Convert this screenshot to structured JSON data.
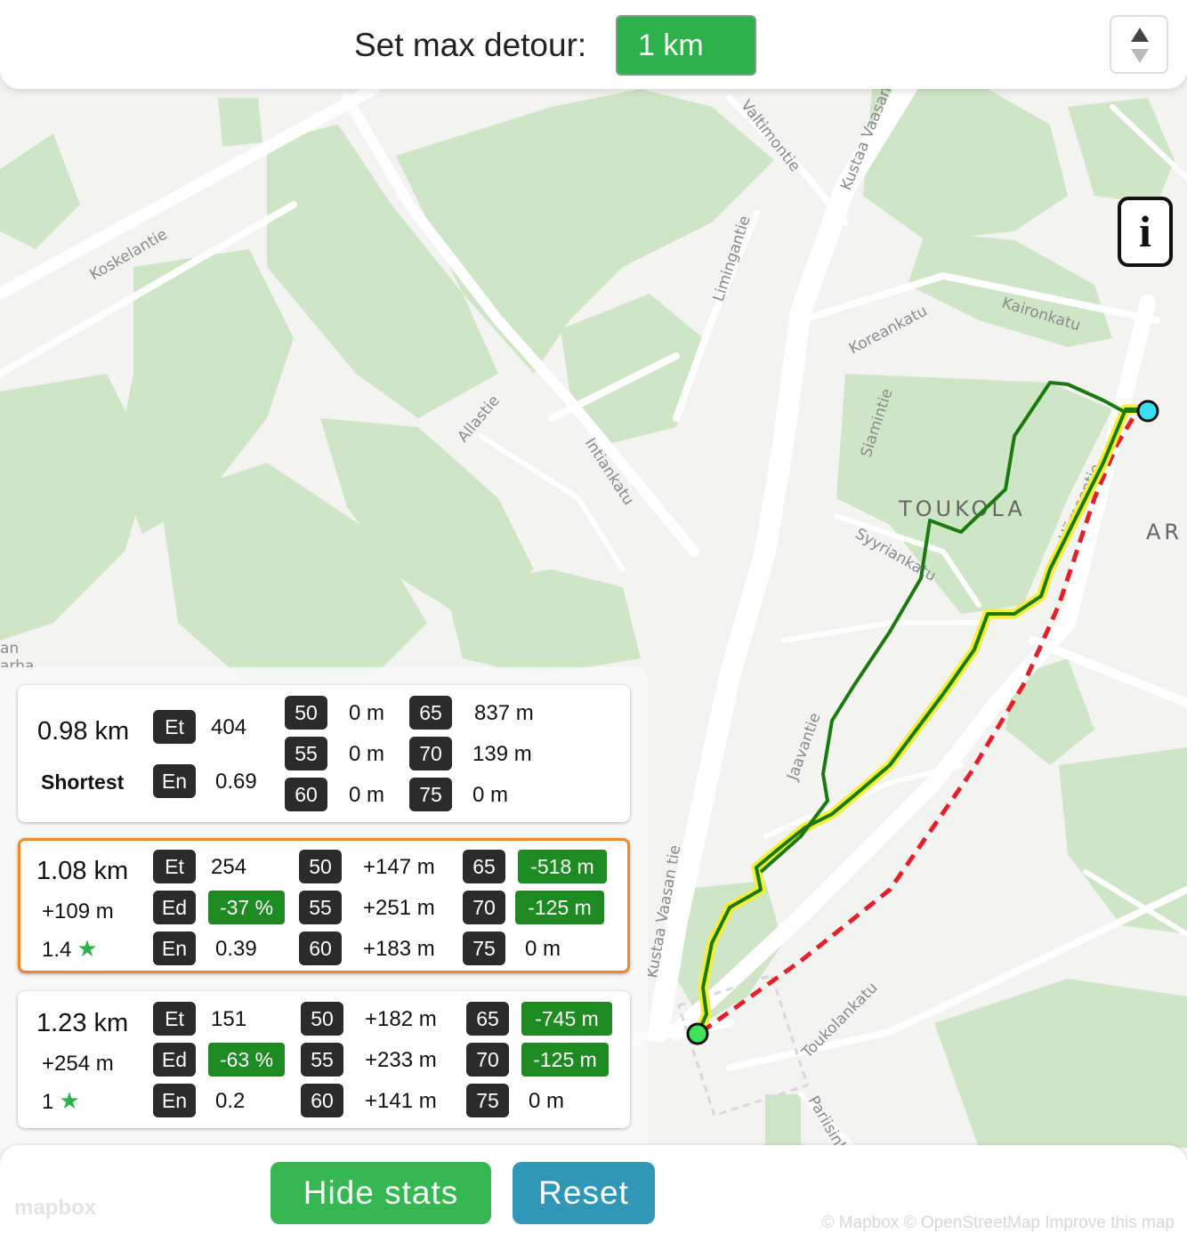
{
  "header": {
    "title": "Set max detour:",
    "detour_value": "1 km"
  },
  "map": {
    "info_label": "i",
    "street_labels": [
      "Koskelantie",
      "Valtimontie",
      "Kustaa Vaasan tie",
      "Limingantie",
      "Koreankatu",
      "Kaironkatu",
      "Allastie",
      "Intiankatu",
      "Siamintie",
      "Syyriankatu",
      "Jaavantie",
      "Toukolankatu",
      "Pariisinkatu",
      "Kustaa Vaasan tie",
      "Hämeentie"
    ],
    "area_labels": [
      "TOUKOLA",
      "AR"
    ],
    "edge_labels": [
      "an",
      "arha"
    ],
    "attribution": "© Mapbox © OpenStreetMap Improve this map",
    "logo": "mapbox"
  },
  "routes": [
    {
      "distance": "0.98 km",
      "subtitle": "Shortest",
      "et": "404",
      "en": "0.69",
      "levels": [
        {
          "db": "50",
          "value": "0 m"
        },
        {
          "db": "55",
          "value": "0 m"
        },
        {
          "db": "60",
          "value": "0 m"
        },
        {
          "db": "65",
          "value": "837 m"
        },
        {
          "db": "70",
          "value": "139 m"
        },
        {
          "db": "75",
          "value": "0 m"
        }
      ]
    },
    {
      "distance": "1.08 km",
      "extra": "+109 m",
      "score": "1.4",
      "et": "254",
      "ed": "-37 %",
      "en": "0.39",
      "levels": [
        {
          "db": "50",
          "value": "+147 m"
        },
        {
          "db": "55",
          "value": "+251 m"
        },
        {
          "db": "60",
          "value": "+183 m"
        },
        {
          "db": "65",
          "value": "-518 m"
        },
        {
          "db": "70",
          "value": "-125 m"
        },
        {
          "db": "75",
          "value": "0 m"
        }
      ]
    },
    {
      "distance": "1.23 km",
      "extra": "+254 m",
      "score": "1",
      "et": "151",
      "ed": "-63 %",
      "en": "0.2",
      "levels": [
        {
          "db": "50",
          "value": "+182 m"
        },
        {
          "db": "55",
          "value": "+233 m"
        },
        {
          "db": "60",
          "value": "+141 m"
        },
        {
          "db": "65",
          "value": "-745 m"
        },
        {
          "db": "70",
          "value": "-125 m"
        },
        {
          "db": "75",
          "value": "0 m"
        }
      ]
    }
  ],
  "tags": {
    "et": "Et",
    "ed": "Ed",
    "en": "En"
  },
  "buttons": {
    "hide_stats": "Hide stats",
    "reset": "Reset"
  },
  "colors": {
    "accent_green": "#2db14a",
    "positive_box": "#1e8a22",
    "tag_dark": "#2b2b2b",
    "selected_border": "#ee8a2a",
    "reset_blue": "#3197b7",
    "route_green": "#1a7a10",
    "route_highlight": "#f4f03a",
    "shortest_route": "#e5202a",
    "origin_marker": "#3ee35a",
    "destination_marker": "#35e0f0"
  },
  "icons": [
    "sort-icon",
    "info-icon",
    "star-icon",
    "origin-marker-icon",
    "destination-marker-icon"
  ]
}
